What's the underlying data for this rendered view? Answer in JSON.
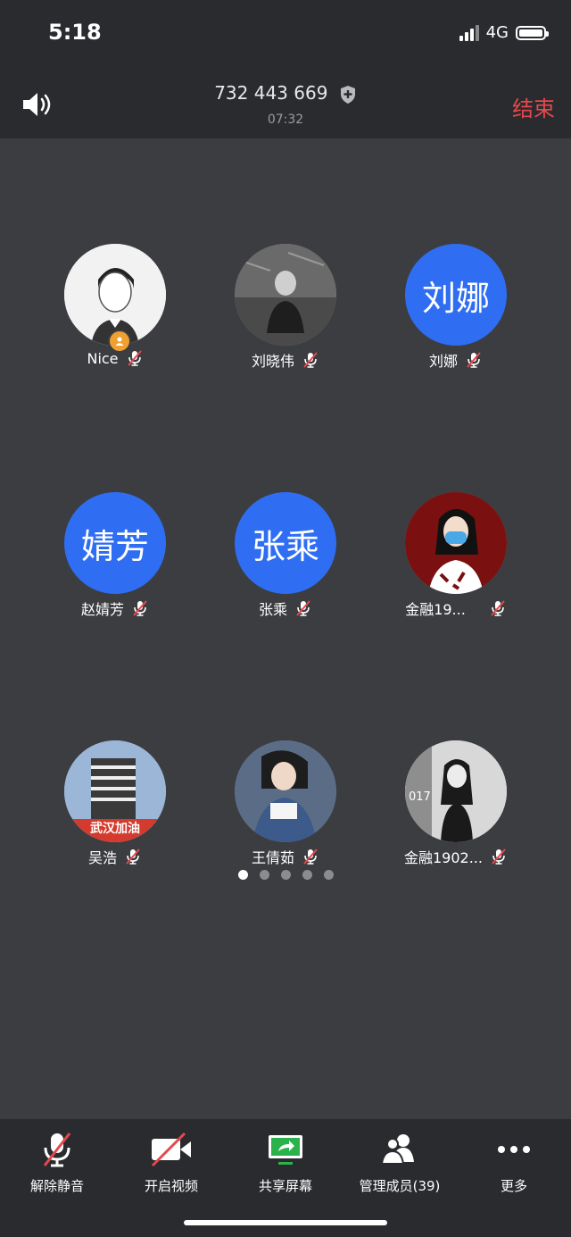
{
  "status_bar": {
    "time": "5:18",
    "network": "4G"
  },
  "header": {
    "meeting_id": "732 443 669",
    "timer": "07:32",
    "end_label": "结束"
  },
  "participants": [
    {
      "name": "Nice",
      "avatar_text": "",
      "host": true
    },
    {
      "name": "刘晓伟",
      "avatar_text": ""
    },
    {
      "name": "刘娜",
      "avatar_text": "刘娜"
    },
    {
      "name": "赵婧芳",
      "avatar_text": "婧芳"
    },
    {
      "name": "张乘",
      "avatar_text": "张乘"
    },
    {
      "name": "金融19...",
      "avatar_text": ""
    },
    {
      "name": "吴浩",
      "avatar_text": "",
      "badge_text": "武汉加油"
    },
    {
      "name": "王倩茹",
      "avatar_text": ""
    },
    {
      "name": "金融1902...",
      "avatar_text": "",
      "photo_text": "017"
    }
  ],
  "pager": {
    "pages": 5,
    "active": 0
  },
  "toolbar": {
    "unmute": "解除静音",
    "video": "开启视频",
    "share": "共享屏幕",
    "members": "管理成员(39)",
    "more": "更多"
  },
  "colors": {
    "accent": "#2f6ef2",
    "danger": "#e5484d",
    "background": "#3b3d41",
    "bar": "#2a2b2e",
    "share_green": "#2bb24c"
  }
}
